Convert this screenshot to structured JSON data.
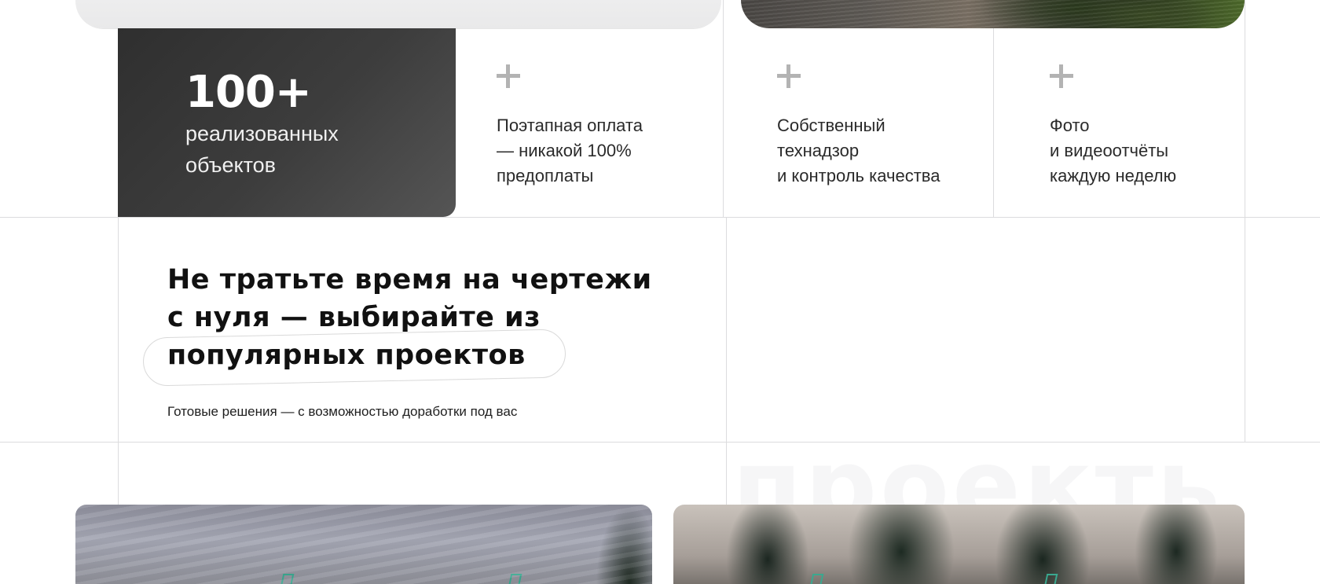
{
  "stats": {
    "number": "100+",
    "label": "реализованных объектов"
  },
  "features": [
    {
      "icon": "plus-icon",
      "text": "Поэтапная оплата\n— никакой 100%\nпредоплаты"
    },
    {
      "icon": "plus-icon",
      "text": "Собственный\nтехнадзор\nи контроль качества"
    },
    {
      "icon": "plus-icon",
      "text": "Фото\nи видеоотчёты\nкаждую неделю"
    }
  ],
  "projects_section": {
    "headline_lines": [
      "Не тратьте время на чертежи",
      "с нуля — выбирайте из",
      "популярных проектов"
    ],
    "subtitle": "Готовые решения — с возможностью доработки под вас",
    "watermark": "проекты"
  },
  "colors": {
    "dark_card": "#3d3d3d",
    "accent_green": "#3aa88f",
    "grid_line": "#dcdcde"
  }
}
